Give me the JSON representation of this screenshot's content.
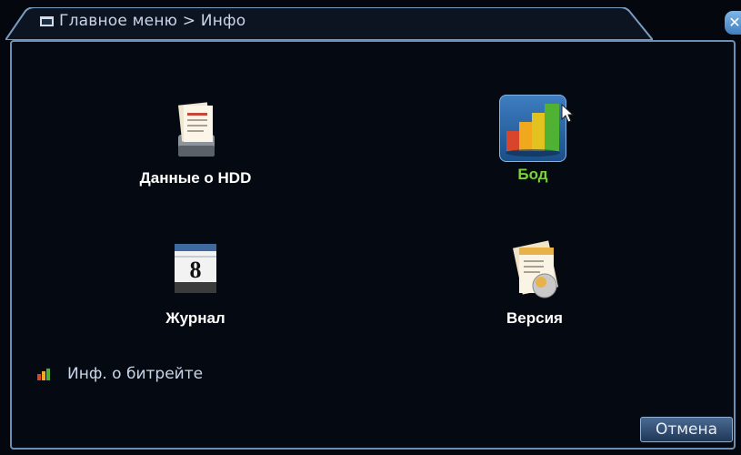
{
  "header": {
    "title": "Главное меню > Инфо"
  },
  "menu": {
    "items": [
      {
        "label": "Данные о HDD",
        "icon": "hdd-report-icon"
      },
      {
        "label": "Бод",
        "icon": "bar-chart-icon",
        "selected": true
      },
      {
        "label": "Журнал",
        "icon": "calendar-log-icon",
        "calendar_day": "8"
      },
      {
        "label": "Версия",
        "icon": "version-document-icon"
      }
    ]
  },
  "bitrate_link": {
    "label": "Инф. о битрейте",
    "icon": "bitrate-bars-icon"
  },
  "footer": {
    "cancel_label": "Отмена"
  },
  "colors": {
    "selected_text": "#79d23a",
    "frame": "#6c8fb6",
    "background": "#04070d"
  }
}
